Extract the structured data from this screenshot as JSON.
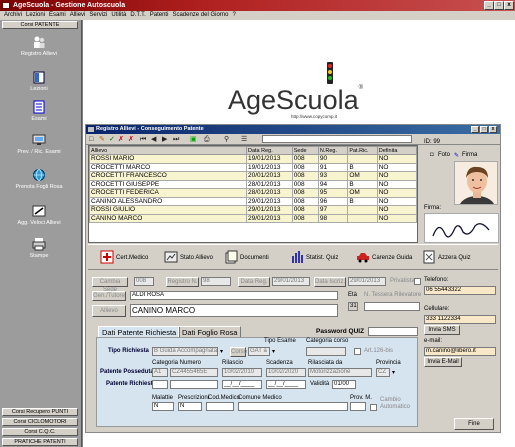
{
  "app": {
    "title": "AgeScuola - Gestione Autoscuola"
  },
  "menu": [
    "Archivi",
    "Lezioni",
    "Esami",
    "Allievi",
    "Servizi",
    "Utilità",
    "D.T.T.",
    "Patenti",
    "Scadenze del Giorno",
    "?"
  ],
  "sidebar": {
    "top_header": "Corsi PATENTE",
    "items": [
      {
        "label": "Registro Allievi",
        "icon": "students-icon"
      },
      {
        "label": "Lezioni",
        "icon": "book-icon"
      },
      {
        "label": "Esami",
        "icon": "exam-icon"
      },
      {
        "label": "Prev. / Ric. Esami",
        "icon": "monitor-icon"
      },
      {
        "label": "Prenota Fogli Rosa",
        "icon": "globe-icon"
      },
      {
        "label": "Agg. Veloci Allievi",
        "icon": "edit-icon"
      },
      {
        "label": "Stampe",
        "icon": "printer-icon"
      }
    ],
    "bottom_headers": [
      "Corsi Recupero PUNTI",
      "Corsi CICLOMOTORI",
      "Corsi C.Q.C.",
      "PRATICHE PATENTI"
    ]
  },
  "logo": {
    "text": "AgeScuola",
    "reg": "®",
    "url": "http://www.copycomp.it"
  },
  "window": {
    "title": "Registro Allievi - Conseguimento Patente",
    "id_label": "ID: 99",
    "photo_label": "Foto",
    "signature_label": "Firma",
    "firma_label": "Firma:",
    "table": {
      "headers": [
        "Allievo",
        "Data Reg.",
        "Sede",
        "N.Reg.",
        "Pat.Ric.",
        "Definita"
      ],
      "rows": [
        [
          "ROSSI MARIO",
          "19/01/2013",
          "008",
          "90",
          "",
          "NO"
        ],
        [
          "CROCETTI MARCO",
          "19/01/2013",
          "008",
          "91",
          "B",
          "NO"
        ],
        [
          "CROCETTI FRANCESCO",
          "20/01/2013",
          "008",
          "93",
          "OM",
          "NO"
        ],
        [
          "CROCETTI GIUSEPPE",
          "28/01/2013",
          "008",
          "94",
          "B",
          "NO"
        ],
        [
          "CROCETTI FEDERICA",
          "28/01/2013",
          "008",
          "95",
          "OM",
          "NO"
        ],
        [
          "CANINO ALESSANDRO",
          "29/01/2013",
          "008",
          "96",
          "B",
          "NO"
        ],
        [
          "ROSSI GIULIO",
          "29/01/2013",
          "008",
          "97",
          "",
          "NO"
        ],
        [
          "CANINO MARCO",
          "29/01/2013",
          "008",
          "98",
          "",
          "NO"
        ]
      ]
    },
    "buttons": [
      "Cert.Medico",
      "Stato Allievo",
      "Documenti",
      "Statist. Quiz",
      "Carenze Guida",
      "Azzera Quiz"
    ],
    "form": {
      "cambia_sede": "Cambia Sede",
      "sede": "008",
      "registro_label": "Registro N.",
      "registro": "98",
      "data_reg_label": "Data Reg.",
      "data_reg": "29/01/2013",
      "data_iscr_label": "Data Iscriz.",
      "data_iscr": "29/01/2013",
      "privatista": "Privatista",
      "gen_tutore_label": "Gen./Tutore",
      "gen_tutore": "ALDI ROSA",
      "allievo_label": "Allievo",
      "allievo": "CANINO MARCO",
      "eta_label": "Età",
      "eta": "31",
      "tessera_label": "N. Tessera Rilevatore",
      "telefono_label": "Telefono:",
      "telefono": "06 55443322",
      "cellulare_label": "Cellulare:",
      "cellulare": "333 1122334",
      "invia_sms": "Invia SMS",
      "email_label": "e-mail:",
      "email": "m.canino@libero.it",
      "invia_email": "Invia E-Mail",
      "tab1": "Dati Patente Richiesta",
      "tab2": "Dati Foglio Rosa",
      "password_quiz_label": "Password QUIZ",
      "tipo_esame_label": "Tipo Esame",
      "categoria_corso_label": "Categoria corso",
      "tipo_richiesta_label": "Tipo Richiesta",
      "tipo_richiesta": "B Guida Accompagnata",
      "corso_label": "Corso",
      "corso": "GAT a",
      "art_label": "Art.126-bis",
      "categoria_numero_label": "Categoria Numero",
      "rilascio_label": "Rilascio",
      "scadenza_label": "Scadenza",
      "rilasciata_label": "Rilasciata da",
      "provincia_label": "Provincia",
      "patente_posseduta_label": "Patente Posseduta",
      "pp_cat": "A1",
      "pp_num": "CZ4455465E",
      "pp_ril": "10/02/2010",
      "pp_sca": "10/02/2020",
      "pp_rda": "Motorizzazione",
      "pp_prov": "CZ",
      "patente_richiesta_label": "Patente Richiesta",
      "pr_ril": "__/__/____",
      "pr_sca": "__/__/____",
      "validita_label": "Validità",
      "validita": "01/00",
      "malattie_label": "Malattie",
      "prescrizioni_label": "Prescrizioni",
      "cod_medico_label": "Cod.Medico",
      "comune_medico_label": "Comune Medico",
      "prov_m_label": "Prov. M.",
      "malattie": "N",
      "prescrizioni": "N",
      "cambio_label": "Cambio Automatico",
      "fine": "Fine"
    }
  }
}
